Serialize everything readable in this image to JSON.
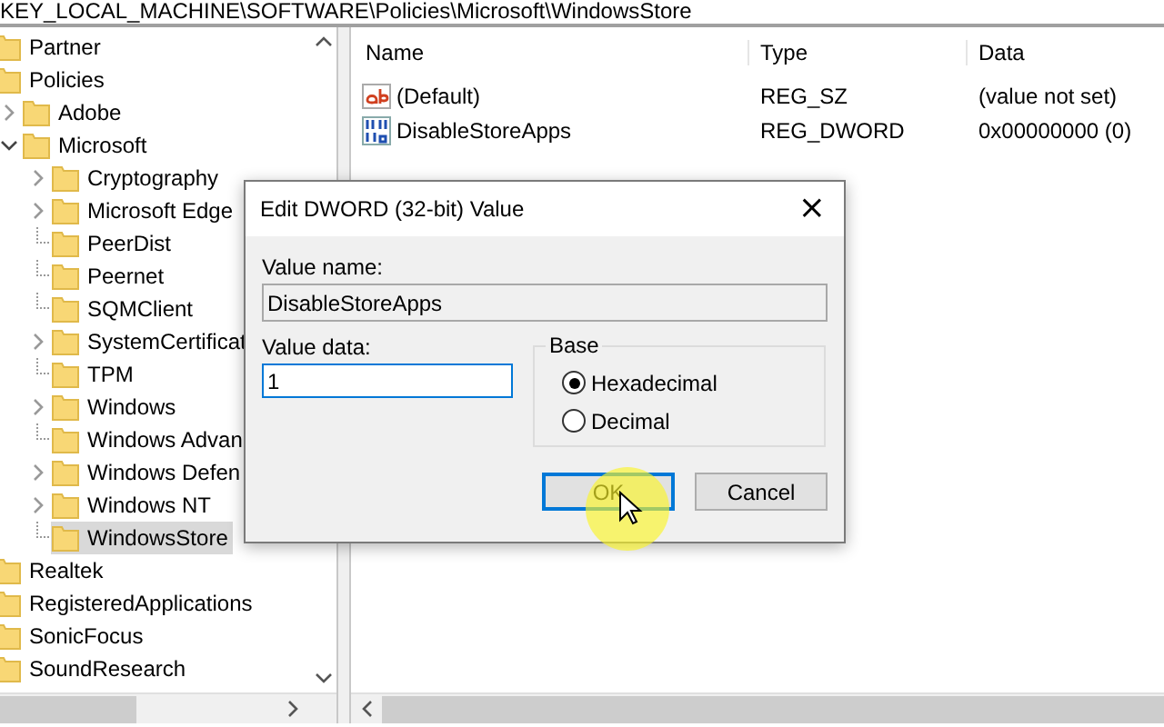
{
  "address_bar": {
    "path": "KEY_LOCAL_MACHINE\\SOFTWARE\\Policies\\Microsoft\\WindowsStore"
  },
  "tree": [
    {
      "label": "Partner",
      "selected": false
    },
    {
      "label": "Policies",
      "selected": false,
      "children": [
        {
          "label": "Adobe",
          "selected": false,
          "expanded": false
        },
        {
          "label": "Microsoft",
          "selected": false,
          "expanded": true,
          "children": [
            {
              "label": "Cryptography",
              "selected": false,
              "expanded": false
            },
            {
              "label": "Microsoft Edge",
              "selected": false,
              "expanded": false
            },
            {
              "label": "PeerDist",
              "selected": false
            },
            {
              "label": "Peernet",
              "selected": false
            },
            {
              "label": "SQMClient",
              "selected": false
            },
            {
              "label": "SystemCertificat",
              "selected": false,
              "expanded": false
            },
            {
              "label": "TPM",
              "selected": false
            },
            {
              "label": "Windows",
              "selected": false,
              "expanded": false
            },
            {
              "label": "Windows Advan",
              "selected": false
            },
            {
              "label": "Windows Defen",
              "selected": false,
              "expanded": false
            },
            {
              "label": "Windows NT",
              "selected": false,
              "expanded": false
            },
            {
              "label": "WindowsStore",
              "selected": true
            }
          ]
        }
      ]
    },
    {
      "label": "Realtek",
      "selected": false
    },
    {
      "label": "RegisteredApplications",
      "selected": false
    },
    {
      "label": "SonicFocus",
      "selected": false
    },
    {
      "label": "SoundResearch",
      "selected": false
    }
  ],
  "values": {
    "columns": [
      "Name",
      "Type",
      "Data"
    ],
    "rows": [
      {
        "kind": "string",
        "name": "(Default)",
        "type": "REG_SZ",
        "data": "(value not set)"
      },
      {
        "kind": "binary",
        "name": "DisableStoreApps",
        "type": "REG_DWORD",
        "data": "0x00000000 (0)"
      }
    ]
  },
  "dialog": {
    "title": "Edit DWORD (32-bit) Value",
    "close": "×",
    "value_name_label": "Value name:",
    "value_name": "DisableStoreApps",
    "value_data_label": "Value data:",
    "value_data": "1",
    "base": {
      "label": "Base",
      "options": [
        {
          "label": "Hexadecimal",
          "selected": true
        },
        {
          "label": "Decimal",
          "selected": false
        }
      ]
    },
    "buttons": [
      {
        "label": "OK",
        "focused": true
      },
      {
        "label": "Cancel",
        "focused": false
      }
    ]
  }
}
